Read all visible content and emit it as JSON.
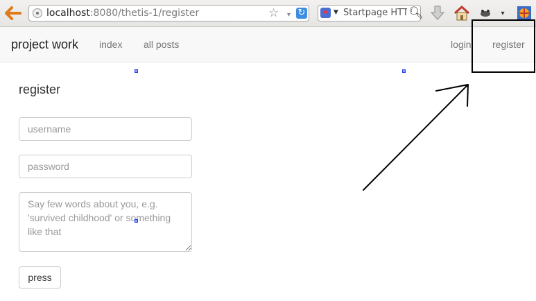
{
  "browser": {
    "url_host": "localhost",
    "url_rest": ":8080/thetis-1/register",
    "search_engine": "Startpage HTT",
    "icons": [
      "back-arrow-icon",
      "site-identity-icon",
      "bookmark-star-icon",
      "reload-icon",
      "search-engine-icon",
      "search-go-icon",
      "download-icon",
      "home-icon",
      "addon-icon",
      "menu-dropdown-icon",
      "firefox-addon-icon"
    ]
  },
  "nav": {
    "brand": "project work",
    "links": [
      "index",
      "all posts"
    ],
    "login": "login",
    "register": "register"
  },
  "form": {
    "title": "register",
    "username_placeholder": "username",
    "password_placeholder": "password",
    "about_placeholder": "Say few words about you, e.g. 'survived childhood' or something like that",
    "submit_label": "press"
  },
  "colors": {
    "navbar_bg": "#f8f8f8",
    "link": "#777777",
    "annotation_box": "#000000",
    "marker": "#2a3cf0"
  }
}
